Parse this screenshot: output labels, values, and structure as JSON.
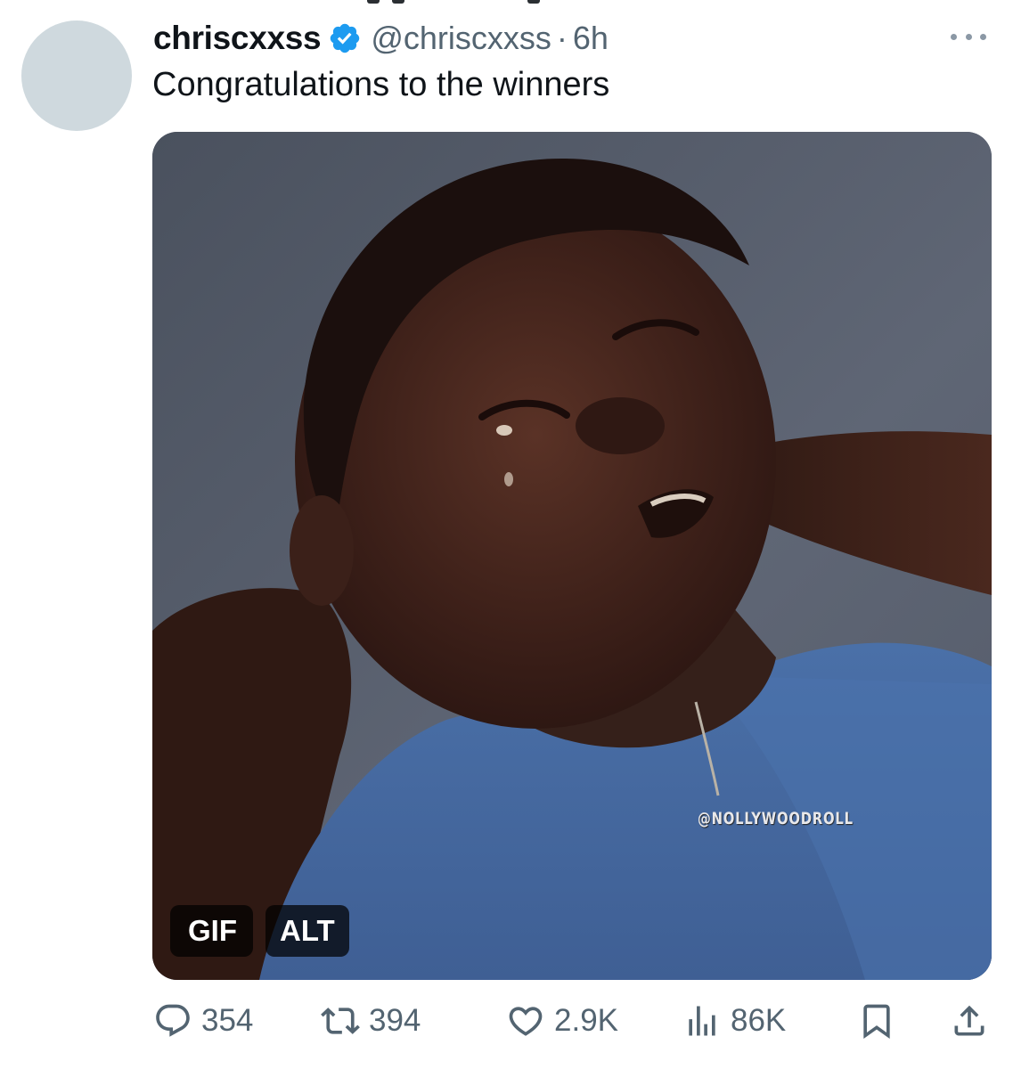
{
  "tweet": {
    "display_name": "chriscxxss",
    "verified": true,
    "handle": "@chriscxxss",
    "separator": "·",
    "time": "6h",
    "text": "Congratulations to the winners"
  },
  "media": {
    "type": "gif",
    "gif_label": "GIF",
    "alt_label": "ALT",
    "watermark": "@NOLLYWOODROLL"
  },
  "actions": {
    "replies": "354",
    "reposts": "394",
    "likes": "2.9K",
    "views": "86K"
  },
  "colors": {
    "text_primary": "#0f1419",
    "text_secondary": "#536471",
    "verified_blue": "#1d9bf0",
    "avatar_placeholder": "#cfd9de"
  },
  "icons": {
    "verified": "verified-badge-icon",
    "more": "more-dots-icon",
    "reply": "reply-bubble-icon",
    "repost": "repost-arrows-icon",
    "like": "heart-icon",
    "views": "bar-chart-icon",
    "bookmark": "bookmark-icon",
    "share": "share-upload-icon"
  }
}
